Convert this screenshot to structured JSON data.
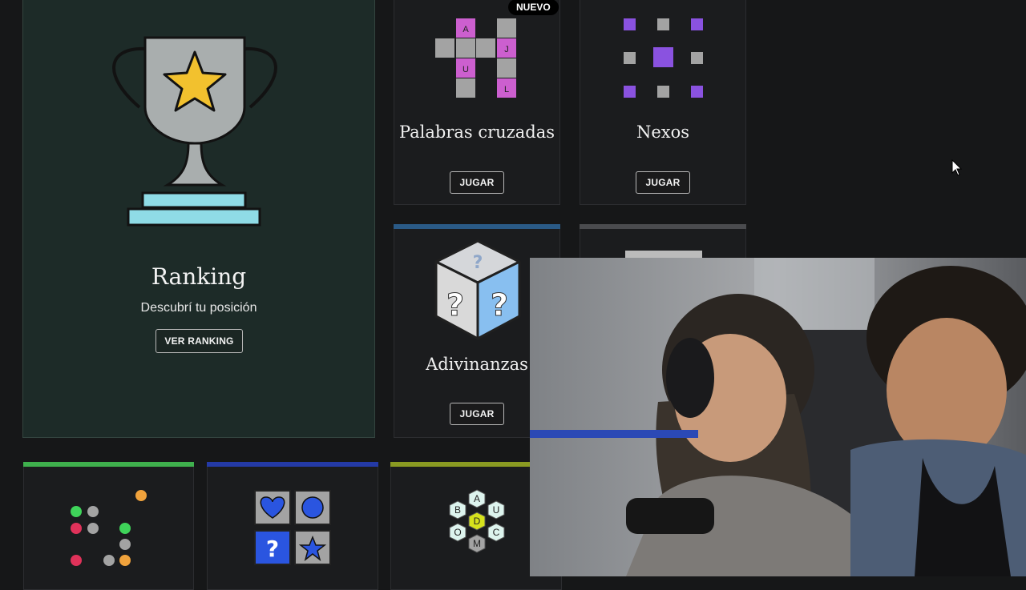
{
  "ranking": {
    "title": "Ranking",
    "subtitle": "Descubrí tu posición",
    "button": "VER RANKING"
  },
  "games": [
    {
      "title": "Palabras cruzadas",
      "button": "JUGAR",
      "badge": "NUEVO",
      "letters": [
        "A",
        "J",
        "U",
        "L"
      ]
    },
    {
      "title": "Nexos",
      "button": "JUGAR"
    },
    {
      "title": "Adivinanzas",
      "button": "JUGAR"
    }
  ],
  "hexagon_letters": {
    "center": "D",
    "ring": [
      "A",
      "U",
      "C",
      "M",
      "O",
      "B"
    ]
  },
  "colors": {
    "background": "#161718",
    "ranking_card": "#1d2b28",
    "crossword_pink": "#cc5fcf",
    "nexos_purple": "#8a52e0",
    "bar_blue": "#2a5a86",
    "bar_green": "#3fb04d",
    "bar_navy": "#243aa6",
    "bar_olive": "#8a9a22"
  },
  "icons": [
    "trophy-icon",
    "crossword-icon",
    "nexos-icon",
    "riddle-cube-icon",
    "dots-game-icon",
    "shapes-game-icon",
    "hexagon-letters-icon",
    "mouse-cursor-icon"
  ]
}
